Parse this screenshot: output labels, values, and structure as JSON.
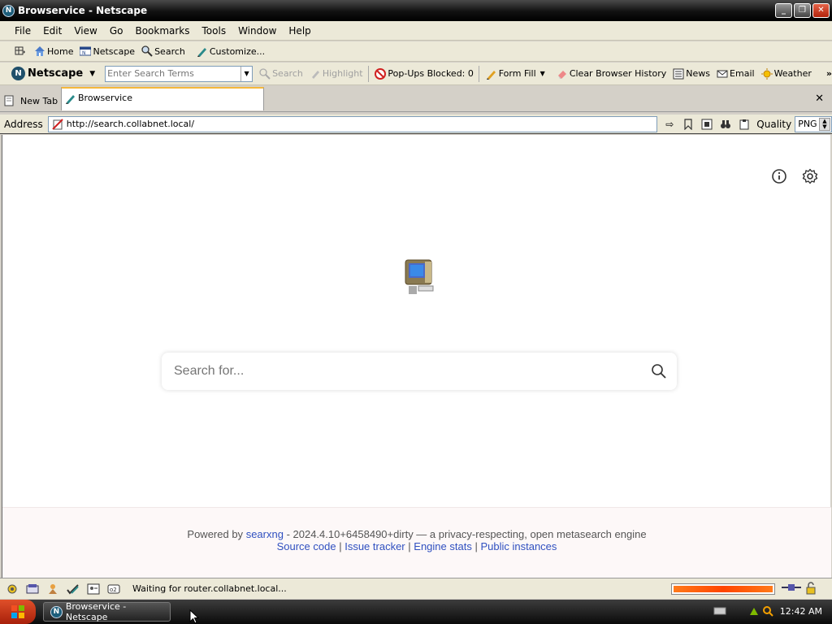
{
  "window": {
    "title": "Browservice - Netscape"
  },
  "menu": [
    "File",
    "Edit",
    "View",
    "Go",
    "Bookmarks",
    "Tools",
    "Window",
    "Help"
  ],
  "nav": {
    "home": "Home",
    "netscape": "Netscape",
    "search": "Search",
    "customize": "Customize..."
  },
  "searchbar": {
    "brand": "Netscape",
    "placeholder": "Enter Search Terms",
    "search": "Search",
    "highlight": "Highlight",
    "popups": "Pop-Ups Blocked: 0",
    "formfill": "Form Fill",
    "clear_history": "Clear Browser History",
    "news": "News",
    "email": "Email",
    "weather": "Weather"
  },
  "tabs": [
    {
      "label": "New Tab"
    },
    {
      "label": "Browservice"
    }
  ],
  "address": {
    "label": "Address",
    "url": "http://search.collabnet.local/",
    "quality_label": "Quality",
    "format": "PNG"
  },
  "page": {
    "search_placeholder": "Search for...",
    "footer": {
      "powered_by": "Powered by",
      "engine": "searxng",
      "version_text": "- 2024.4.10+6458490+dirty — a privacy-respecting, open metasearch engine",
      "links": [
        "Source code",
        "Issue tracker",
        "Engine stats",
        "Public instances"
      ]
    }
  },
  "status": {
    "text": "Waiting for router.collabnet.local...",
    "progress": 1.0
  },
  "taskbar": {
    "item": "Browservice - Netscape",
    "clock": "12:42 AM"
  },
  "colors": {
    "link": "#3050c0",
    "progress": "#ff4500",
    "tab_accent": "#f5b83d"
  }
}
